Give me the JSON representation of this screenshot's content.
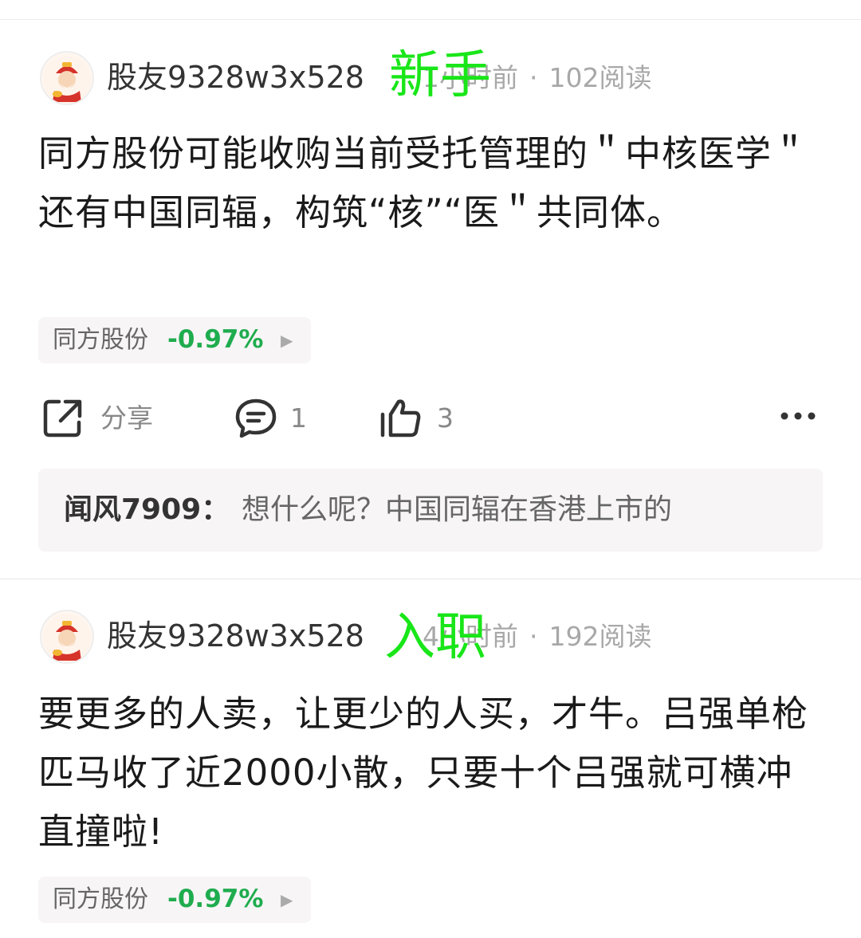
{
  "posts": [
    {
      "username": "股友9328w3x528",
      "time": "1小时前",
      "reads": "102阅读",
      "overlay": "新手",
      "content": "同方股份可能收购当前受托管理的＂中核医学＂还有中国同辐，构筑“核”“医＂共同体。",
      "stock": {
        "name": "同方股份",
        "change": "-0.97%"
      },
      "actions": {
        "share": "分享",
        "comments": "1",
        "likes": "3"
      },
      "top_comment": {
        "user": "闻风7909：",
        "text": "想什么呢？中国同辐在香港上市的"
      }
    },
    {
      "username": "股友9328w3x528",
      "time": "4小时前",
      "reads": "192阅读",
      "overlay": "入职",
      "content": "要更多的人卖，让更少的人买，才牛。吕强单枪匹马收了近2000小散，只要十个吕强就可横冲直撞啦!",
      "stock": {
        "name": "同方股份",
        "change": "-0.97%"
      }
    }
  ],
  "colors": {
    "overlay": "#19e619",
    "stock_down": "#1fac4e",
    "tag_bg": "#f7f5f6"
  },
  "icons": [
    "avatar-fortune-god-icon",
    "share-icon",
    "comment-icon",
    "like-icon",
    "more-icon",
    "triangle-right-icon"
  ]
}
